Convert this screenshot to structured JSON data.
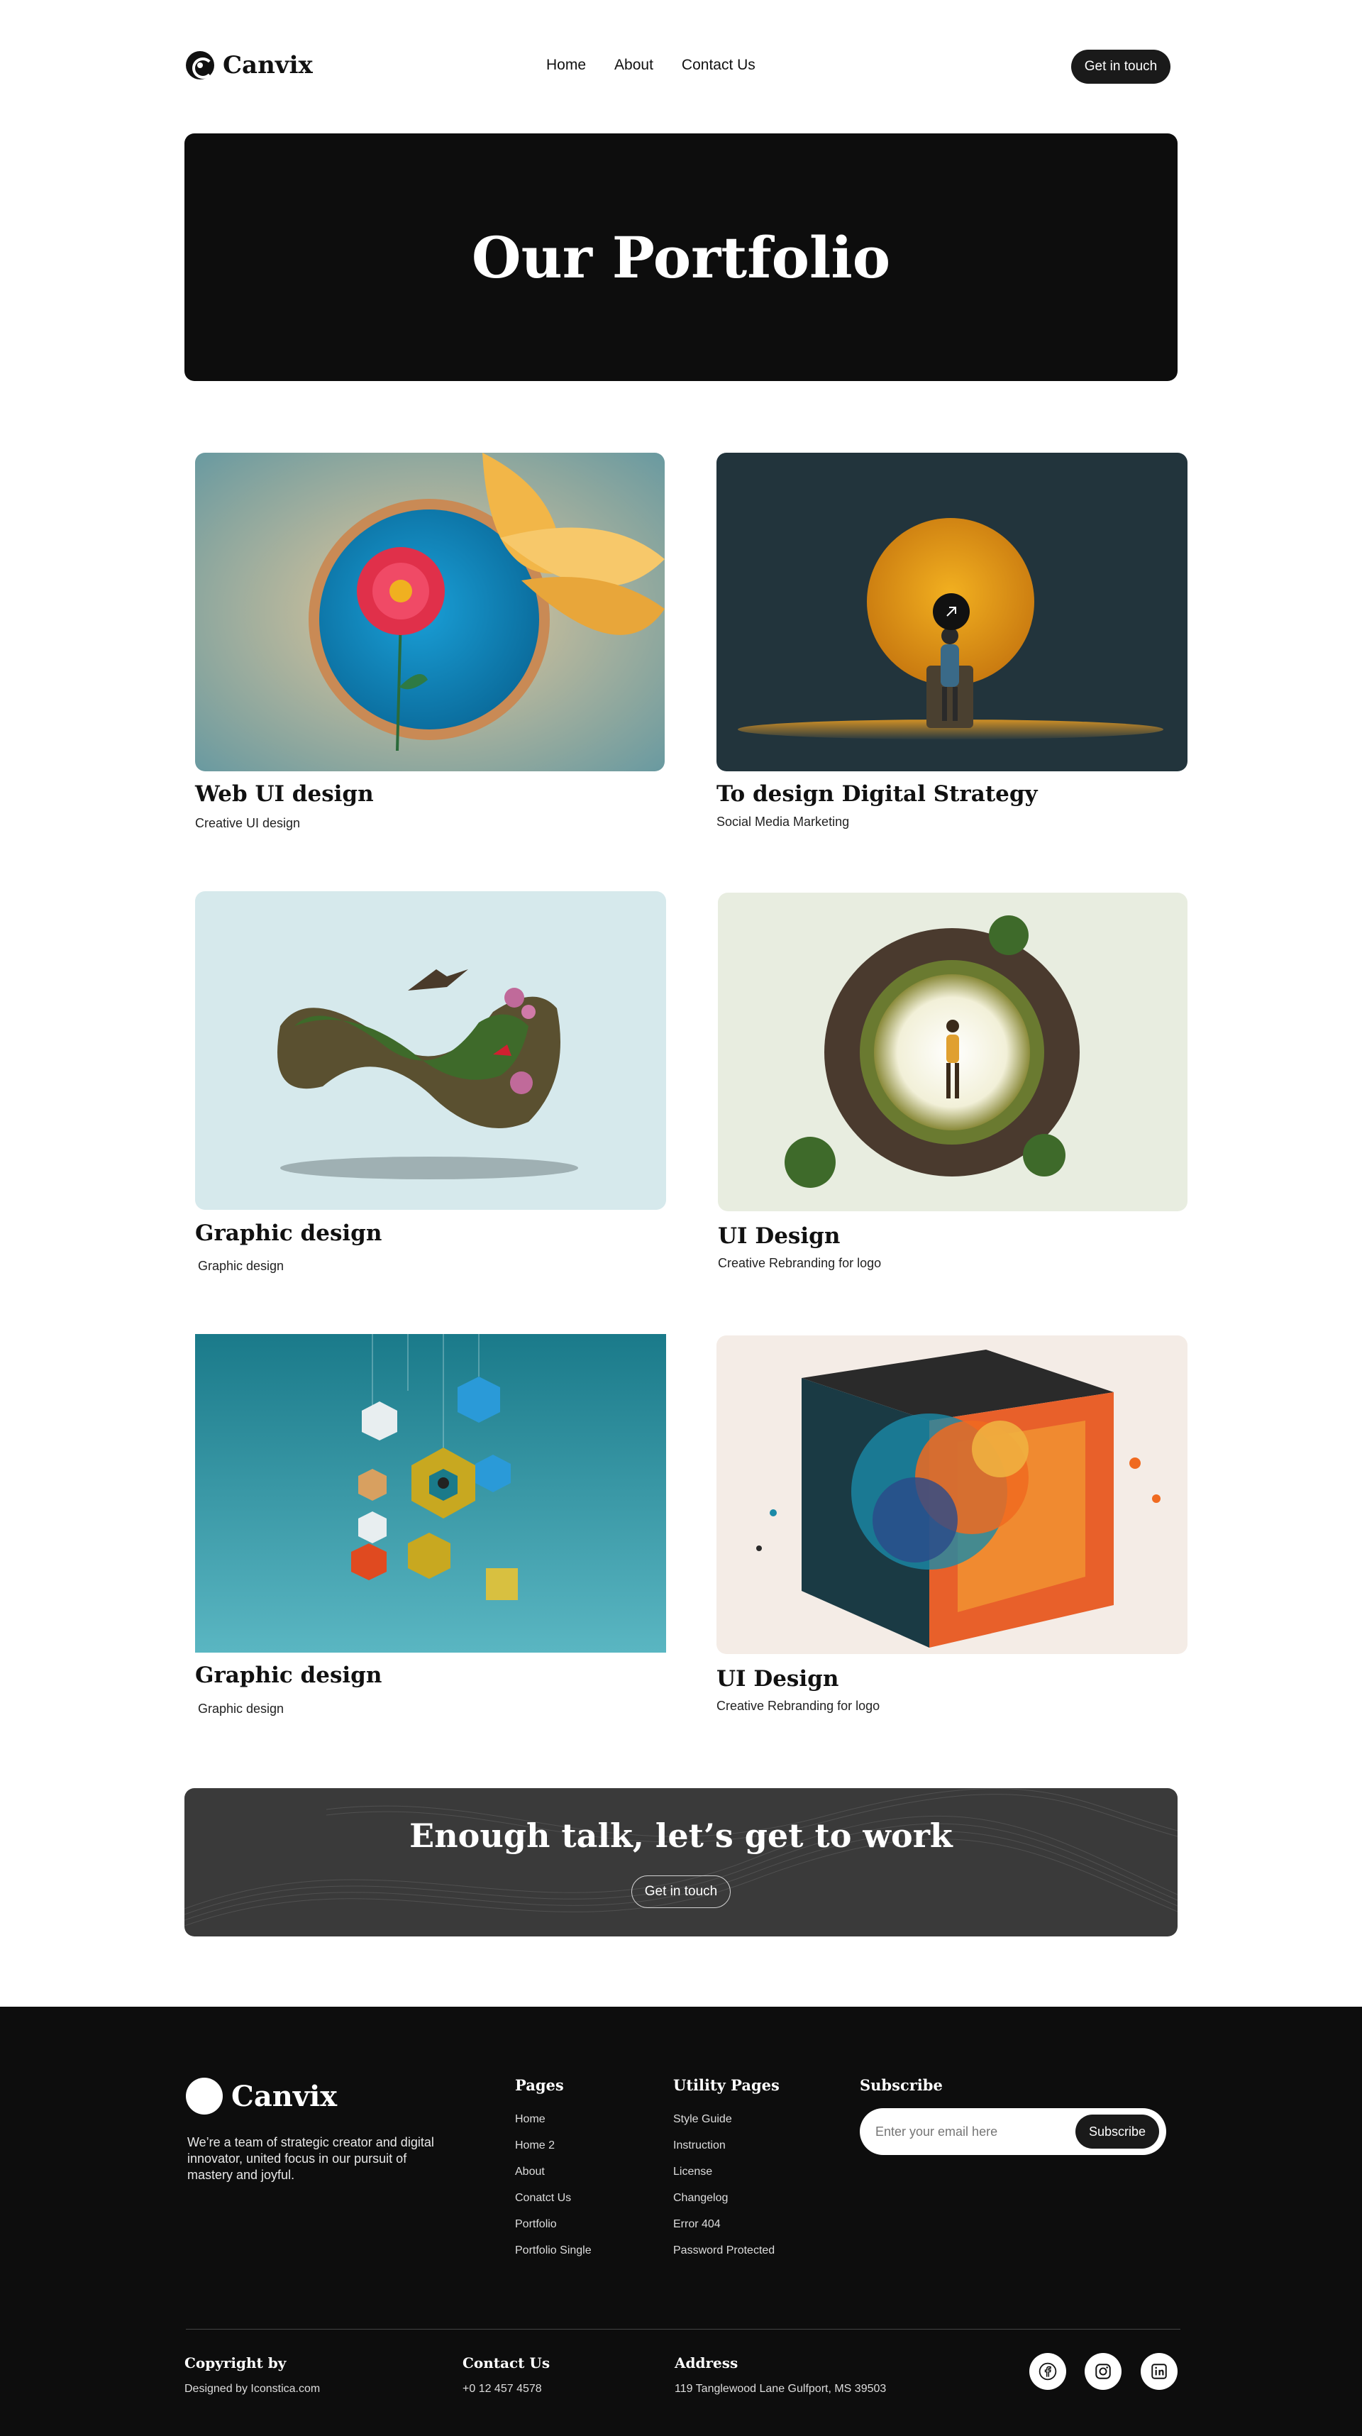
{
  "header": {
    "brand": "Canvix",
    "nav": [
      "Home",
      "About",
      "Contact Us"
    ],
    "cta_label": "Get in touch"
  },
  "hero": {
    "title": "Our Portfolio"
  },
  "portfolio": [
    {
      "title": "Web UI design",
      "subtitle": "Creative  UI design",
      "image": "flower-in-blue-bowl"
    },
    {
      "title": "To design Digital Strategy",
      "subtitle": "Social Media Marketing",
      "image": "figure-before-orange-sun"
    },
    {
      "title": "Graphic design",
      "subtitle": "Graphic design",
      "image": "mobius-island-with-eagle"
    },
    {
      "title": "UI Design",
      "subtitle": "Creative Rebranding for logo",
      "image": "hiker-in-floating-earth-ring"
    },
    {
      "title": "Graphic design",
      "subtitle": "Graphic design",
      "image": "hanging-hexagon-sculpture"
    },
    {
      "title": "UI Design",
      "subtitle": "Creative Rebranding for logo",
      "image": "exploding-colorful-cube"
    }
  ],
  "cta": {
    "title": "Enough talk, let’s get to work",
    "button": "Get in touch"
  },
  "footer": {
    "brand": "Canvix",
    "about": "We’re a team of strategic creator and digital innovator, united focus in our pursuit of mastery and joyful.",
    "pages": {
      "title": "Pages",
      "links": [
        "Home",
        "Home 2",
        "About",
        "Conatct Us",
        "Portfolio",
        "Portfolio Single"
      ]
    },
    "utility": {
      "title": "Utility Pages",
      "links": [
        "Style Guide",
        "Instruction",
        "License",
        "Changelog",
        "Error  404",
        "Password Protected"
      ]
    },
    "subscribe": {
      "title": "Subscribe",
      "placeholder": "Enter your email here",
      "button": "Subscribe"
    },
    "copyright": {
      "title": "Copyright by",
      "text": "Designed by Iconstica.com"
    },
    "contact": {
      "title": "Contact Us",
      "text": "+0 12 457 4578"
    },
    "address": {
      "title": "Address",
      "text": "119 Tanglewood Lane Gulfport, MS 39503"
    },
    "socials": [
      "facebook-icon",
      "instagram-icon",
      "linkedin-icon"
    ]
  },
  "colors": {
    "dark": "#0d0d0d",
    "cta_bg": "#3a3a3a",
    "accent_orange": "#e8a020",
    "teal": "#1f7f8e"
  }
}
